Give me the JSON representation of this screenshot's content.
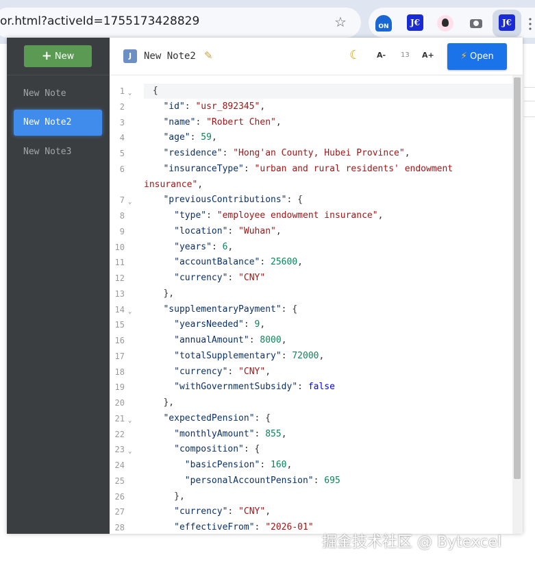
{
  "browser": {
    "url": "or.html?activeId=1755173428829",
    "extensions": [
      {
        "icon": "on-extension-icon",
        "label": "ON"
      },
      {
        "icon": "je-extension-icon",
        "label": "J€"
      },
      {
        "icon": "avatar-extension-icon"
      },
      {
        "icon": "camera-icon"
      },
      {
        "icon": "je-extension-icon",
        "label": "J€"
      }
    ]
  },
  "sidebar": {
    "new_label": "New",
    "notes": [
      {
        "label": "New Note",
        "active": false
      },
      {
        "label": "New Note2",
        "active": true
      },
      {
        "label": "New Note3",
        "active": false
      }
    ]
  },
  "toolbar": {
    "badge": "J",
    "title": "New Note2",
    "font_decrease": "A-",
    "font_size": "13",
    "font_increase": "A+",
    "open_label": "Open"
  },
  "editor": {
    "lines": [
      {
        "n": "1",
        "fold": true,
        "indent": 0,
        "html": [
          [
            "p",
            "{"
          ]
        ]
      },
      {
        "n": "2",
        "indent": 1,
        "html": [
          [
            "k",
            "\"id\""
          ],
          [
            "p",
            ": "
          ],
          [
            "s",
            "\"usr_892345\""
          ],
          [
            "p",
            ","
          ]
        ]
      },
      {
        "n": "3",
        "indent": 1,
        "html": [
          [
            "k",
            "\"name\""
          ],
          [
            "p",
            ": "
          ],
          [
            "s",
            "\"Robert Chen\""
          ],
          [
            "p",
            ","
          ]
        ]
      },
      {
        "n": "4",
        "indent": 1,
        "html": [
          [
            "k",
            "\"age\""
          ],
          [
            "p",
            ": "
          ],
          [
            "n",
            "59"
          ],
          [
            "p",
            ","
          ]
        ]
      },
      {
        "n": "5",
        "indent": 1,
        "html": [
          [
            "k",
            "\"residence\""
          ],
          [
            "p",
            ": "
          ],
          [
            "s",
            "\"Hong'an County, Hubei Province\""
          ],
          [
            "p",
            ","
          ]
        ]
      },
      {
        "n": "6",
        "indent": 1,
        "html": [
          [
            "k",
            "\"insuranceType\""
          ],
          [
            "p",
            ": "
          ],
          [
            "s",
            "\"urban and rural residents' endowment"
          ]
        ]
      },
      {
        "n": "",
        "cont": true,
        "html": [
          [
            "s",
            "insurance\""
          ],
          [
            "p",
            ","
          ]
        ]
      },
      {
        "n": "7",
        "fold": true,
        "indent": 1,
        "html": [
          [
            "k",
            "\"previousContributions\""
          ],
          [
            "p",
            ": {"
          ]
        ]
      },
      {
        "n": "8",
        "indent": 2,
        "html": [
          [
            "k",
            "\"type\""
          ],
          [
            "p",
            ": "
          ],
          [
            "s",
            "\"employee endowment insurance\""
          ],
          [
            "p",
            ","
          ]
        ]
      },
      {
        "n": "9",
        "indent": 2,
        "html": [
          [
            "k",
            "\"location\""
          ],
          [
            "p",
            ": "
          ],
          [
            "s",
            "\"Wuhan\""
          ],
          [
            "p",
            ","
          ]
        ]
      },
      {
        "n": "10",
        "indent": 2,
        "html": [
          [
            "k",
            "\"years\""
          ],
          [
            "p",
            ": "
          ],
          [
            "n",
            "6"
          ],
          [
            "p",
            ","
          ]
        ]
      },
      {
        "n": "11",
        "indent": 2,
        "html": [
          [
            "k",
            "\"accountBalance\""
          ],
          [
            "p",
            ": "
          ],
          [
            "n",
            "25600"
          ],
          [
            "p",
            ","
          ]
        ]
      },
      {
        "n": "12",
        "indent": 2,
        "html": [
          [
            "k",
            "\"currency\""
          ],
          [
            "p",
            ": "
          ],
          [
            "s",
            "\"CNY\""
          ]
        ]
      },
      {
        "n": "13",
        "indent": 1,
        "html": [
          [
            "p",
            "},"
          ]
        ]
      },
      {
        "n": "14",
        "fold": true,
        "indent": 1,
        "html": [
          [
            "k",
            "\"supplementaryPayment\""
          ],
          [
            "p",
            ": {"
          ]
        ]
      },
      {
        "n": "15",
        "indent": 2,
        "html": [
          [
            "k",
            "\"yearsNeeded\""
          ],
          [
            "p",
            ": "
          ],
          [
            "n",
            "9"
          ],
          [
            "p",
            ","
          ]
        ]
      },
      {
        "n": "16",
        "indent": 2,
        "html": [
          [
            "k",
            "\"annualAmount\""
          ],
          [
            "p",
            ": "
          ],
          [
            "n",
            "8000"
          ],
          [
            "p",
            ","
          ]
        ]
      },
      {
        "n": "17",
        "indent": 2,
        "html": [
          [
            "k",
            "\"totalSupplementary\""
          ],
          [
            "p",
            ": "
          ],
          [
            "n",
            "72000"
          ],
          [
            "p",
            ","
          ]
        ]
      },
      {
        "n": "18",
        "indent": 2,
        "html": [
          [
            "k",
            "\"currency\""
          ],
          [
            "p",
            ": "
          ],
          [
            "s",
            "\"CNY\""
          ],
          [
            "p",
            ","
          ]
        ]
      },
      {
        "n": "19",
        "indent": 2,
        "html": [
          [
            "k",
            "\"withGovernmentSubsidy\""
          ],
          [
            "p",
            ": "
          ],
          [
            "b",
            "false"
          ]
        ]
      },
      {
        "n": "20",
        "indent": 1,
        "html": [
          [
            "p",
            "},"
          ]
        ]
      },
      {
        "n": "21",
        "fold": true,
        "indent": 1,
        "html": [
          [
            "k",
            "\"expectedPension\""
          ],
          [
            "p",
            ": {"
          ]
        ]
      },
      {
        "n": "22",
        "indent": 2,
        "html": [
          [
            "k",
            "\"monthlyAmount\""
          ],
          [
            "p",
            ": "
          ],
          [
            "n",
            "855"
          ],
          [
            "p",
            ","
          ]
        ]
      },
      {
        "n": "23",
        "fold": true,
        "indent": 2,
        "html": [
          [
            "k",
            "\"composition\""
          ],
          [
            "p",
            ": {"
          ]
        ]
      },
      {
        "n": "24",
        "indent": 3,
        "html": [
          [
            "k",
            "\"basicPension\""
          ],
          [
            "p",
            ": "
          ],
          [
            "n",
            "160"
          ],
          [
            "p",
            ","
          ]
        ]
      },
      {
        "n": "25",
        "indent": 3,
        "html": [
          [
            "k",
            "\"personalAccountPension\""
          ],
          [
            "p",
            ": "
          ],
          [
            "n",
            "695"
          ]
        ]
      },
      {
        "n": "26",
        "indent": 2,
        "html": [
          [
            "p",
            "},"
          ]
        ]
      },
      {
        "n": "27",
        "indent": 2,
        "html": [
          [
            "k",
            "\"currency\""
          ],
          [
            "p",
            ": "
          ],
          [
            "s",
            "\"CNY\""
          ],
          [
            "p",
            ","
          ]
        ]
      },
      {
        "n": "28",
        "indent": 2,
        "html": [
          [
            "k",
            "\"effectiveFrom\""
          ],
          [
            "p",
            ": "
          ],
          [
            "s",
            "\"2026-01\""
          ]
        ]
      }
    ]
  },
  "watermark": "掘金技术社区 @ Bytexcel"
}
